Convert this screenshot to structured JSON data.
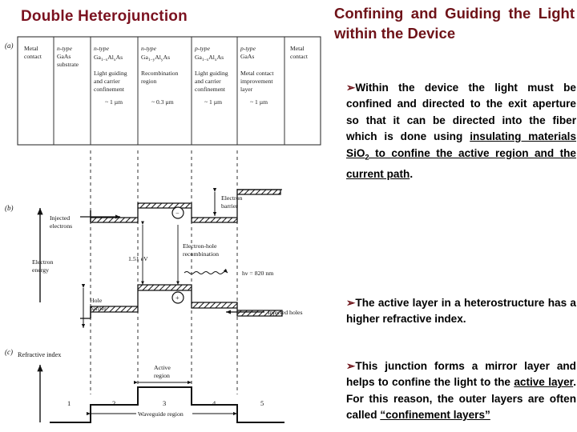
{
  "slide": {
    "title": "Double Heterojunction",
    "title_color": "#7B1220",
    "background": "#ffffff"
  },
  "figure": {
    "panel_a_label": "(a)",
    "panel_b_label": "(b)",
    "panel_c_label": "(c)",
    "layer_table": {
      "columns": [
        {
          "line1": "Metal",
          "line2": "contact",
          "line3": "",
          "line4": "",
          "line5": "",
          "thickness": ""
        },
        {
          "line1": "n-type",
          "line2": "GaAs",
          "line3": "substrate",
          "line4": "",
          "line5": "",
          "thickness": ""
        },
        {
          "line1": "n-type",
          "line2": "Ga1−xAlxAs",
          "line3": "Light guiding",
          "line4": "and carrier",
          "line5": "confinement",
          "thickness": "~ 1 µm"
        },
        {
          "line1": "n-type",
          "line2": "Ga1−yAlyAs",
          "line3": "Recombination",
          "line4": "region",
          "line5": "",
          "thickness": "~ 0.3 µm"
        },
        {
          "line1": "p-type",
          "line2": "Ga1−xAlxAs",
          "line3": "Light guiding",
          "line4": "and carrier",
          "line5": "confinement",
          "thickness": "~ 1 µm"
        },
        {
          "line1": "p-type",
          "line2": "GaAs",
          "line3": "Metal contact",
          "line4": "improvement",
          "line5": "layer",
          "thickness": "~ 1 µm"
        },
        {
          "line1": "Metal",
          "line2": "contact",
          "line3": "",
          "line4": "",
          "line5": "",
          "thickness": ""
        }
      ]
    },
    "band_diagram": {
      "y_axis_label_line1": "Electron",
      "y_axis_label_line2": "energy",
      "injected_electrons_line1": "Injected",
      "injected_electrons_line2": "electrons",
      "injected_holes": "Injected holes",
      "electron_barrier_line1": "Electron",
      "electron_barrier_line2": "barrier",
      "hole_barrier_line1": "Hole",
      "hole_barrier_line2": "barrier",
      "bandgap": "1.51 eV",
      "recombination_line1": "Electron-hole",
      "recombination_line2": "recombination",
      "photon_label": "hν = 820 nm",
      "electron_symbol": "−",
      "hole_symbol": "+"
    },
    "refractive_index": {
      "y_axis_label": "Refractive index",
      "active_region_line1": "Active",
      "active_region_line2": "region",
      "waveguide_label": "Waveguide region",
      "region_numbers": [
        "1",
        "2",
        "3",
        "4",
        "5"
      ]
    }
  },
  "right_panel": {
    "heading": "Confining and Guiding the Light within the Device",
    "bullet_marker": "➢",
    "bullets": [
      {
        "id": "bullet-1",
        "segments": [
          {
            "text": "Within the device the light must be confined and directed to the exit   aperture so that it can be directed into the fiber which is done using ",
            "underline": false
          },
          {
            "text": "insulating materials SiO",
            "underline": true
          },
          {
            "text": "2",
            "underline": true,
            "subscript": true
          },
          {
            "text": " to confine the active region and the current path",
            "underline": true
          },
          {
            "text": ".",
            "underline": false
          }
        ]
      },
      {
        "id": "bullet-2",
        "segments": [
          {
            "text": "The active layer in a heterostructure has a higher refractive index.",
            "underline": false
          }
        ]
      },
      {
        "id": "bullet-3",
        "segments": [
          {
            "text": "This junction forms a mirror layer and helps to confine the light to the ",
            "underline": false
          },
          {
            "text": "active layer",
            "underline": true
          },
          {
            "text": ". For this reason, the outer layers are often called ",
            "underline": false
          },
          {
            "text": "“confinement layers”",
            "underline": true
          }
        ]
      }
    ]
  }
}
